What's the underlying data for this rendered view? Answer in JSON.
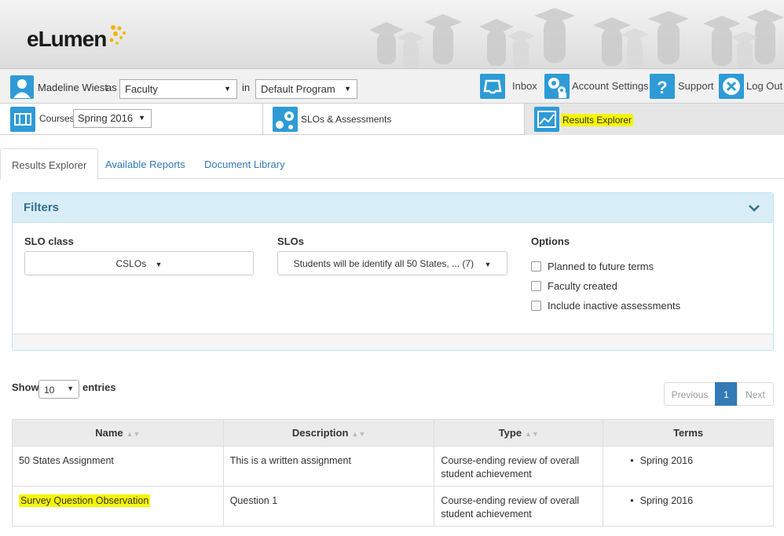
{
  "brand": {
    "logo_text": "eLumen",
    "accent": "#f4b400"
  },
  "userbar": {
    "user_name": "Madeline Wiest",
    "as_label": "as",
    "role_value": "Faculty",
    "in_label": "in",
    "program_value": "Default Program",
    "inbox_label": "Inbox",
    "account_label": "Account Settings",
    "support_label": "Support",
    "logout_label": "Log Out"
  },
  "modules": {
    "courses_label": "Courses",
    "term_value": "Spring 2016",
    "slos_label": "SLOs & Assessments",
    "results_label": "Results Explorer"
  },
  "tabs": [
    "Results Explorer",
    "Available Reports",
    "Document Library"
  ],
  "filters": {
    "title": "Filters",
    "slo_class_label": "SLO class",
    "slo_class_value": "CSLOs",
    "slos_label": "SLOs",
    "slos_value": "Students will be identify all 50 States, ... (7)",
    "options_label": "Options",
    "options": [
      "Planned to future terms",
      "Faculty created",
      "Include inactive assessments"
    ]
  },
  "table_controls": {
    "show_label": "Show",
    "length_value": "10",
    "entries_label": "entries",
    "prev_label": "Previous",
    "page_current": "1",
    "next_label": "Next"
  },
  "table": {
    "headers": [
      "Name",
      "Description",
      "Type",
      "Terms"
    ],
    "rows": [
      {
        "name": "50 States Assignment",
        "description": "This is a written assignment",
        "type": "Course-ending review of overall student achievement",
        "term": "Spring 2016"
      },
      {
        "name": "Survey Question Observation",
        "description": "Question 1",
        "type": "Course-ending review of overall student achievement",
        "term": "Spring 2016"
      }
    ]
  },
  "colors": {
    "icon_blue": "#2e9bd6",
    "link_blue": "#337ab7",
    "panel_head": "#d9edf7",
    "highlight": "#f6f600"
  }
}
